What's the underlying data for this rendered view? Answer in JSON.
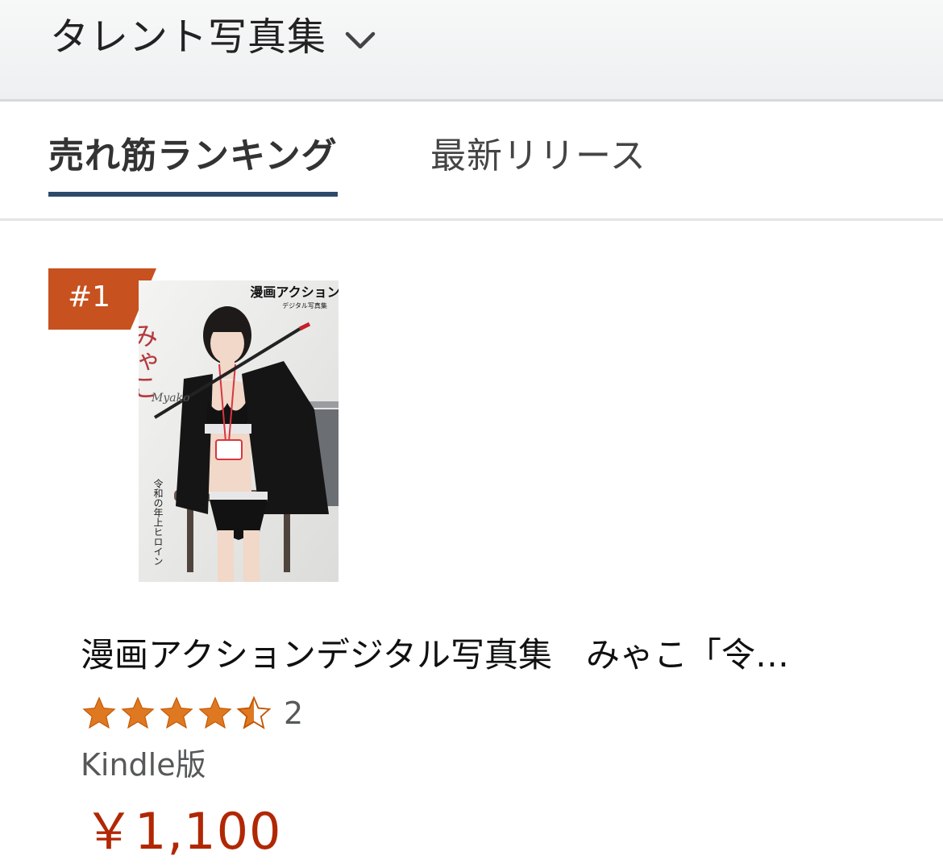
{
  "header": {
    "category_title": "タレント写真集",
    "dropdown_icon": "chevron-down-icon"
  },
  "tabs": [
    {
      "label": "売れ筋ランキング",
      "active": true
    },
    {
      "label": "最新リリース",
      "active": false
    }
  ],
  "product": {
    "rank": "#1",
    "cover": {
      "logo_text": "漫画アクション",
      "logo_subtext": "デジタル写真集",
      "name_text": "みゃこ",
      "name_romaji": "Myako",
      "tagline": "令和の年上ヒロイン"
    },
    "title": "漫画アクションデジタル写真集　みゃこ「令…",
    "rating": {
      "stars": 4.5,
      "max": 5,
      "count": "2"
    },
    "format": "Kindle版",
    "price": "￥1,100"
  },
  "colors": {
    "badge": "#c7511f",
    "tab_underline": "#2d4a6b",
    "star": "#de7921",
    "price": "#b12704"
  }
}
